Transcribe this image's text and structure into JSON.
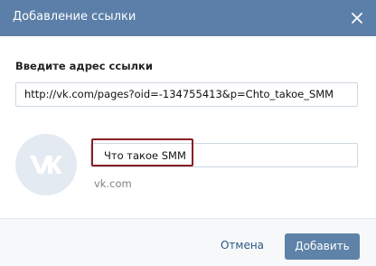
{
  "dialog": {
    "title": "Добавление ссылки",
    "close_icon": "close-icon",
    "url_label": "Введите адрес ссылки",
    "url_value": "http://vk.com/pages?oid=-134755413&p=Chto_takoe_SMM",
    "preview": {
      "logo_icon": "vk-logo-icon",
      "title_value": "Что такое SMM",
      "domain": "vk.com"
    },
    "cancel_label": "Отмена",
    "submit_label": "Добавить"
  },
  "colors": {
    "header_bg": "#5b7fa8",
    "button_bg": "#5e82a8",
    "link": "#2a5885",
    "highlight": "#8b1e22"
  }
}
